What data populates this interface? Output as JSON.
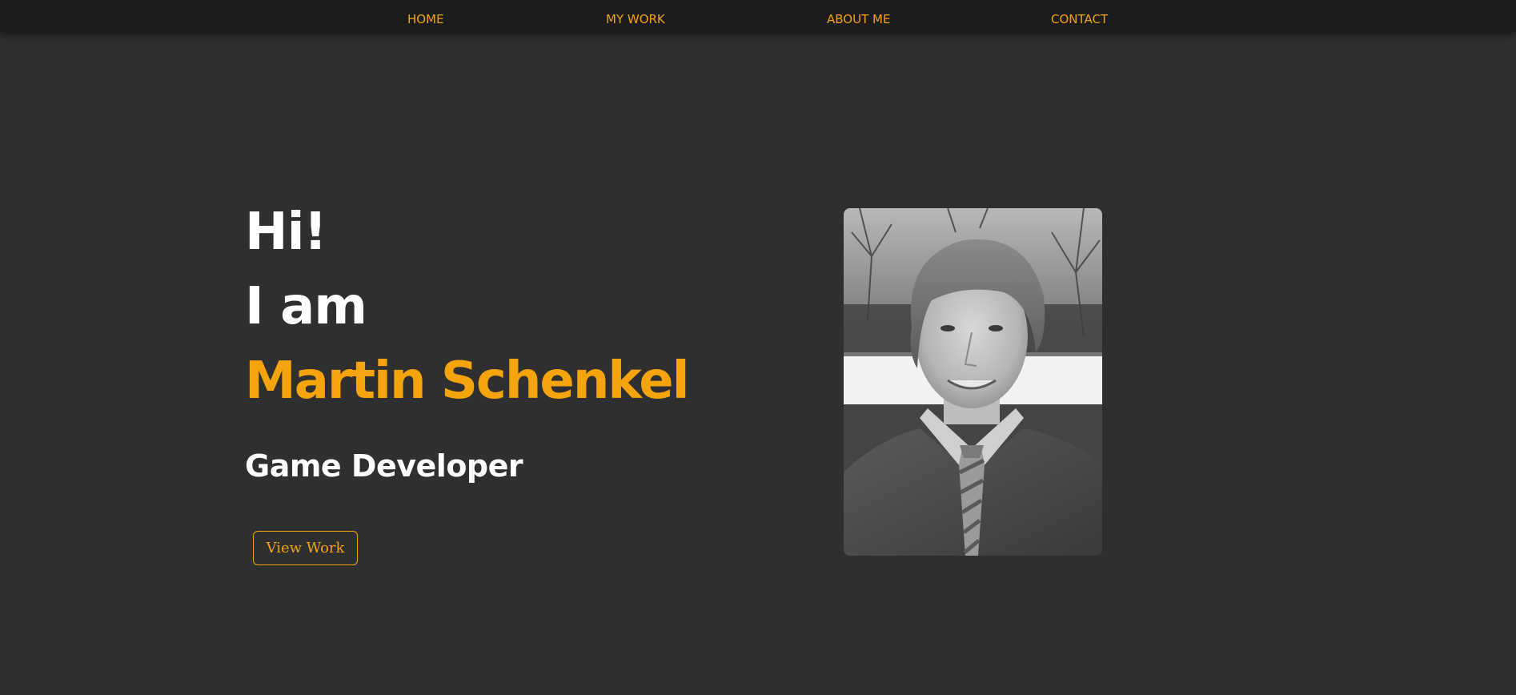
{
  "nav": {
    "items": [
      {
        "label": "HOME"
      },
      {
        "label": "MY WORK"
      },
      {
        "label": "ABOUT ME"
      },
      {
        "label": "CONTACT"
      }
    ]
  },
  "hero": {
    "greeting_line1": "Hi!",
    "greeting_line2": "I am",
    "name": "Martin Schenkel",
    "role": "Game Developer",
    "cta_label": "View Work"
  },
  "colors": {
    "background": "#2f2f2f",
    "navbar": "#1c1c1c",
    "accent": "#f5a40b",
    "text": "#ffffff"
  },
  "portrait": {
    "description_icon": "portrait-photo"
  }
}
